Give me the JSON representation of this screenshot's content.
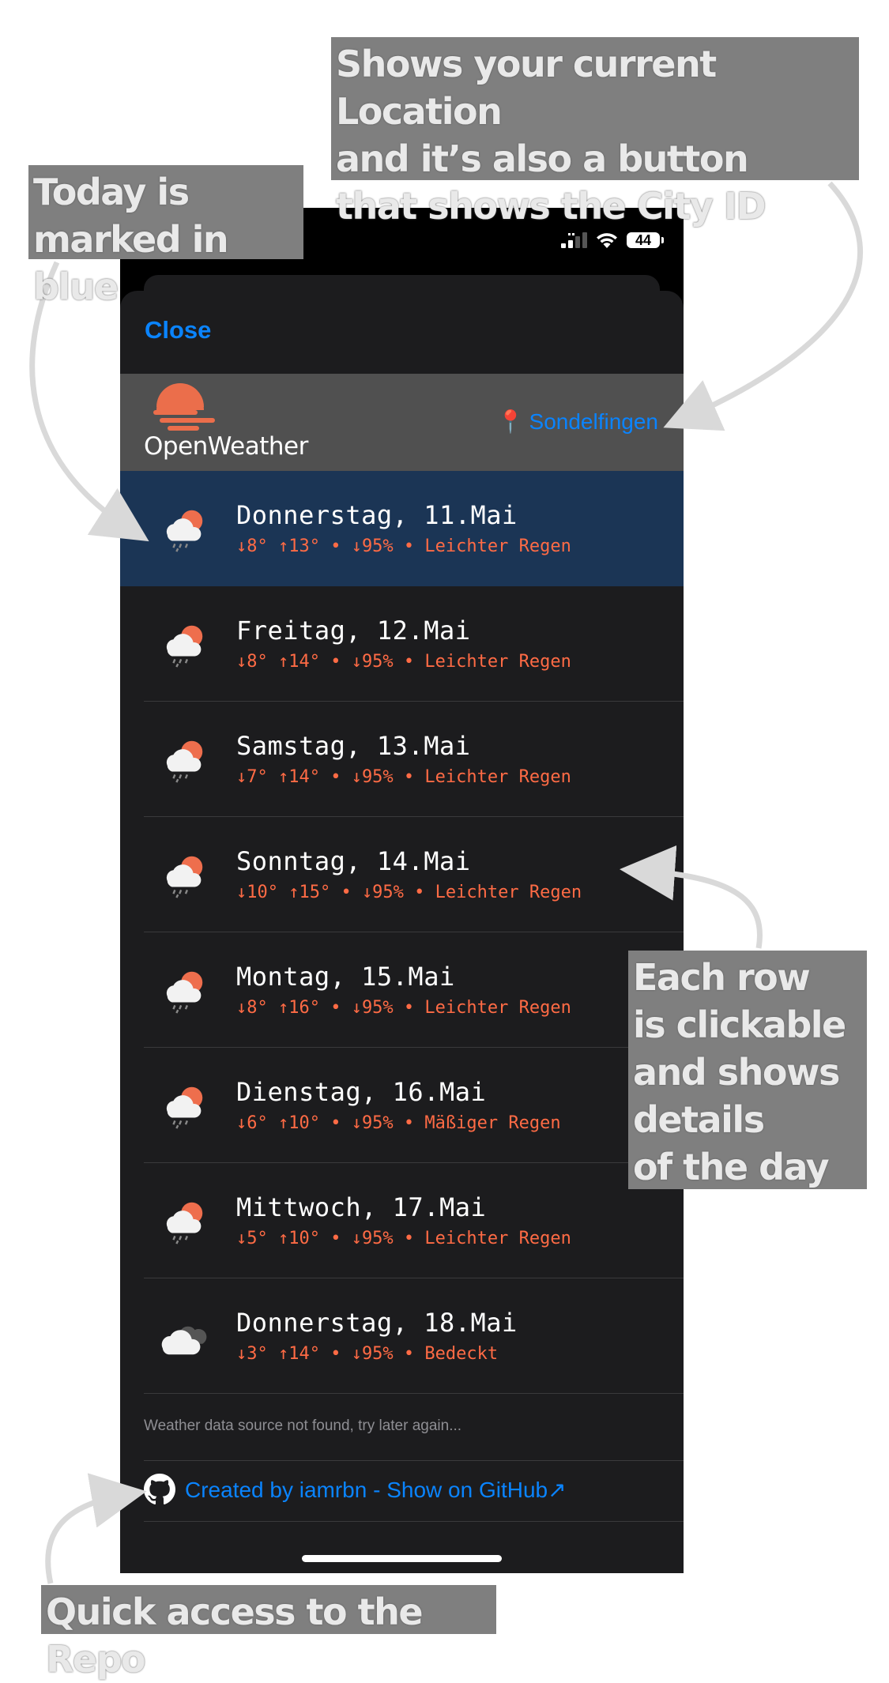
{
  "status_bar": {
    "battery": "44"
  },
  "sheet": {
    "close_label": "Close"
  },
  "header": {
    "logo_text": "OpenWeather",
    "location_pin": "📍",
    "location_label": "Sondelfingen"
  },
  "days": [
    {
      "title": "Donnerstag, 11.Mai",
      "details": "↓8° ↑13° • ↓95% • Leichter Regen",
      "icon": "cloud-sun-rain-icon",
      "today": true
    },
    {
      "title": "Freitag, 12.Mai",
      "details": "↓8° ↑14° • ↓95% • Leichter Regen",
      "icon": "cloud-sun-rain-icon",
      "today": false
    },
    {
      "title": "Samstag, 13.Mai",
      "details": "↓7° ↑14° • ↓95% • Leichter Regen",
      "icon": "cloud-sun-rain-icon",
      "today": false
    },
    {
      "title": "Sonntag, 14.Mai",
      "details": "↓10° ↑15° • ↓95% • Leichter Regen",
      "icon": "cloud-sun-rain-icon",
      "today": false
    },
    {
      "title": "Montag, 15.Mai",
      "details": "↓8° ↑16° • ↓95% • Leichter Regen",
      "icon": "cloud-sun-rain-icon",
      "today": false
    },
    {
      "title": "Dienstag, 16.Mai",
      "details": "↓6° ↑10° • ↓95% • Mäßiger Regen",
      "icon": "cloud-sun-rain-icon",
      "today": false
    },
    {
      "title": "Mittwoch, 17.Mai",
      "details": "↓5° ↑10° • ↓95% • Leichter Regen",
      "icon": "cloud-sun-rain-icon",
      "today": false
    },
    {
      "title": "Donnerstag, 18.Mai",
      "details": "↓3° ↑14° • ↓95% • Bedeckt",
      "icon": "overcast-clouds-icon",
      "today": false
    }
  ],
  "footer": {
    "message": "Weather data source not found, try later again...",
    "github_label": "Created by iamrbn - Show on GitHub↗"
  },
  "annotations": {
    "location": "Shows your current Location\nand it’s also a button\nthat shows the City ID",
    "today": "Today is\nmarked in blue",
    "row": "Each row\nis clickable\nand shows\ndetails\nof the day",
    "repo": "Quick access to the Repo"
  },
  "colors": {
    "accent": "#0a84ff",
    "detail_text": "#ff6b45",
    "today_row": "#1b3555",
    "sheet_bg": "#1c1c1e",
    "header_bg": "#505050",
    "annotation_bg": "#7f7f7f"
  }
}
